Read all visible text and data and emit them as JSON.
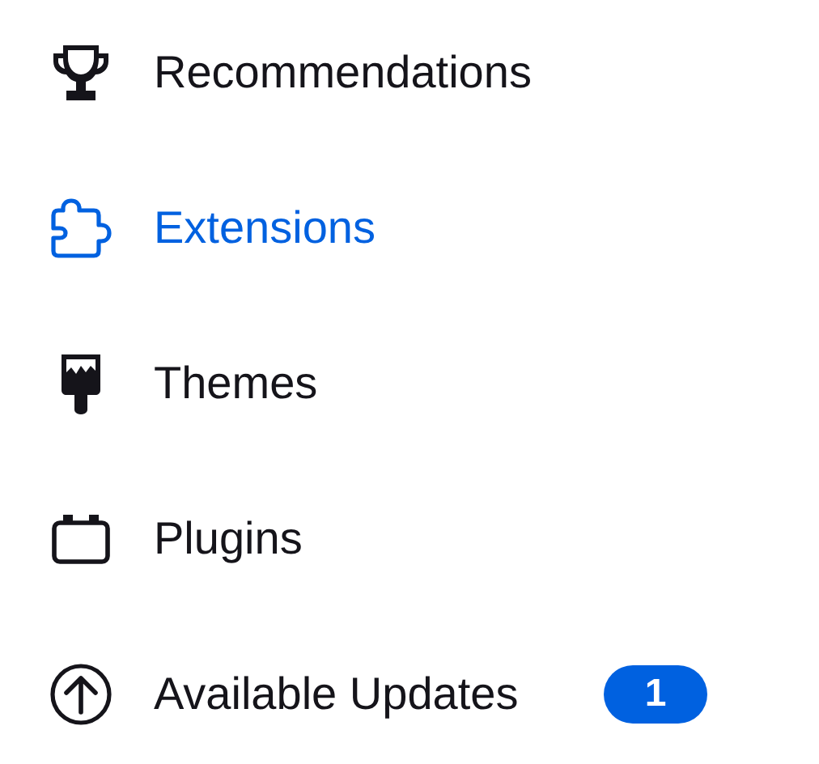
{
  "categories": [
    {
      "kind": "trophy",
      "label": "Recommendations",
      "selected": false
    },
    {
      "kind": "puzzle",
      "label": "Extensions",
      "selected": true
    },
    {
      "kind": "brush",
      "label": "Themes",
      "selected": false
    },
    {
      "kind": "plugin",
      "label": "Plugins",
      "selected": false
    },
    {
      "kind": "updates",
      "label": "Available Updates",
      "selected": false,
      "badge": "1"
    }
  ]
}
